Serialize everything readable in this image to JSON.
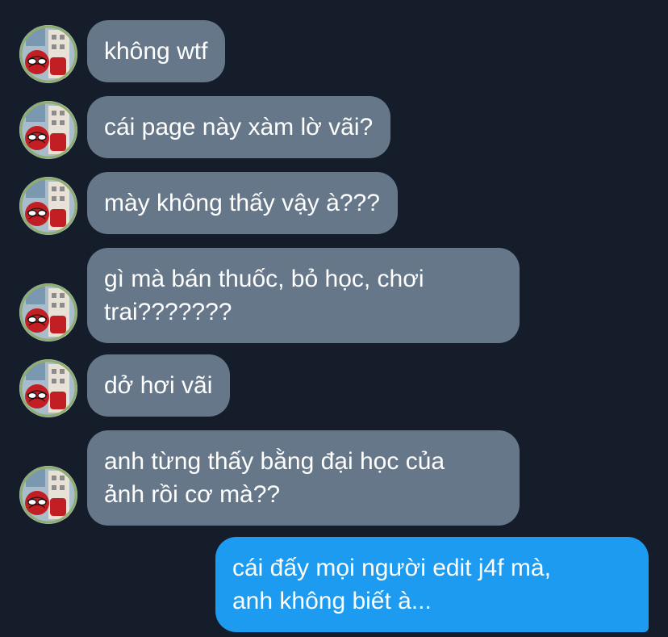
{
  "colors": {
    "background": "#151d2a",
    "incoming_bubble": "#66778a",
    "outgoing_bubble": "#1d9bf0",
    "text": "#ffffff"
  },
  "avatar_icon": "spider-man-avatar-icon",
  "messages": [
    {
      "direction": "incoming",
      "text": "không wtf"
    },
    {
      "direction": "incoming",
      "text": "cái page này xàm lờ vãi?"
    },
    {
      "direction": "incoming",
      "text": "mày không thấy vậy à???"
    },
    {
      "direction": "incoming",
      "text": "gì mà bán thuốc, bỏ học, chơi\ntrai???????"
    },
    {
      "direction": "incoming",
      "text": "dở hơi vãi"
    },
    {
      "direction": "incoming",
      "text": "anh từng thấy bằng đại học của\nảnh rồi cơ mà??"
    },
    {
      "direction": "outgoing",
      "text": "cái đấy mọi người edit j4f mà,\nanh không biết à..."
    }
  ]
}
